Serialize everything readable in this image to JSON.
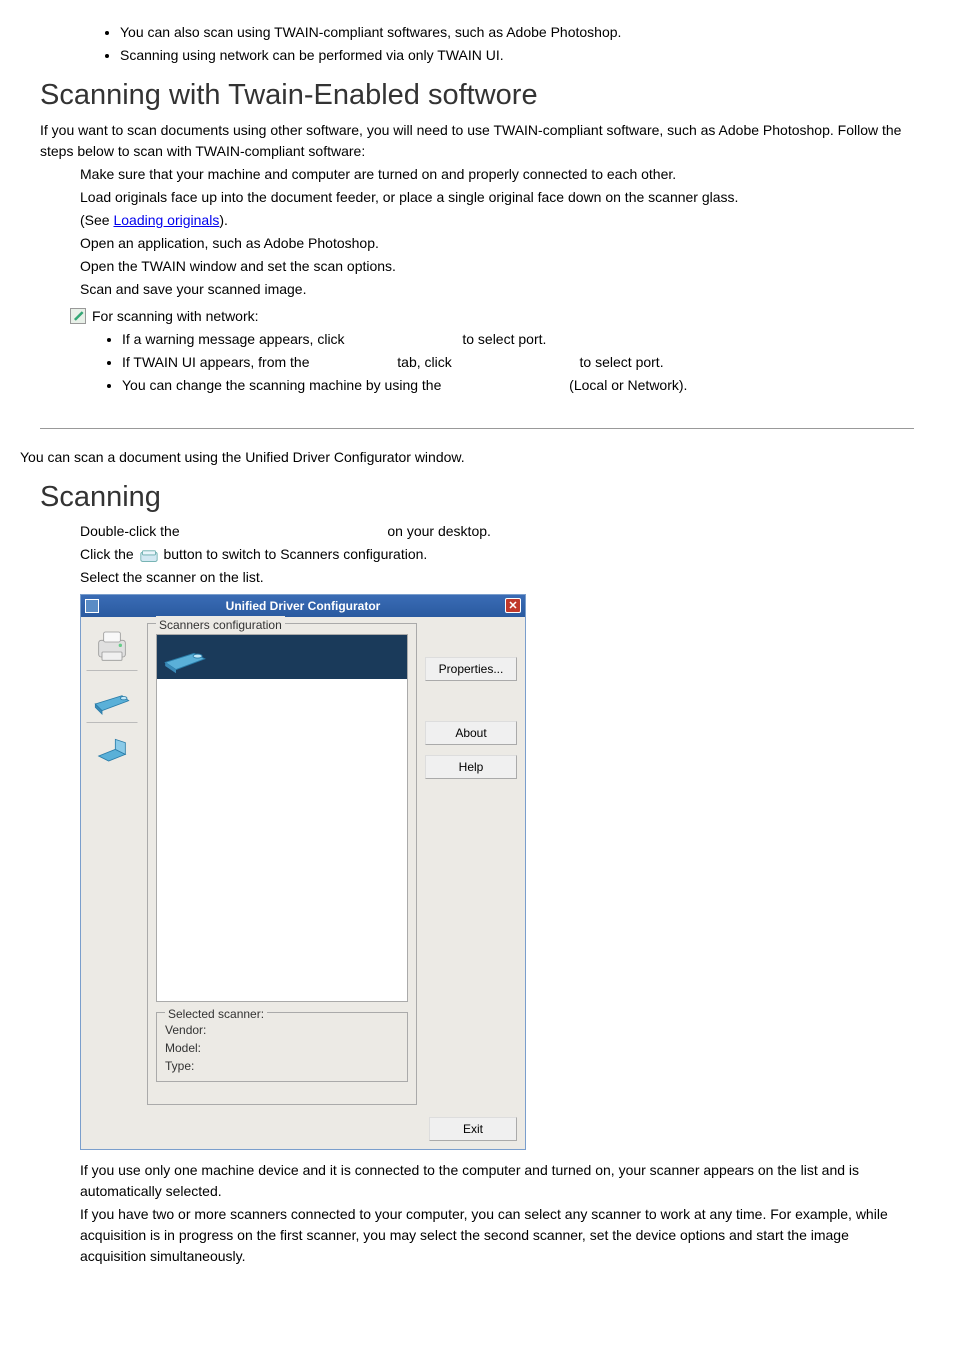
{
  "intro_bullets": [
    "You can also scan using TWAIN-compliant softwares, such as Adobe Photoshop.",
    "Scanning using network can be performed via only TWAIN UI."
  ],
  "section1": {
    "heading": "Scanning with Twain-Enabled softwore",
    "intro": "If you want to scan documents using other software, you will need to use TWAIN-compliant software, such as Adobe Photoshop. Follow the steps below to scan with TWAIN-compliant software:",
    "steps": {
      "s1": "Make sure that your machine and computer are turned on and properly connected to each other.",
      "s2a": "Load originals face up into the document feeder, or place a single original face down on the scanner glass.",
      "s2b_prefix": "(See ",
      "s2b_link": "Loading originals",
      "s2b_suffix": ").",
      "s3": "Open an application, such as Adobe Photoshop.",
      "s4": "Open the TWAIN window and set the scan options.",
      "s5": "Scan and save your scanned image."
    },
    "note_label": "For scanning with network:",
    "note_bullets": {
      "b1a": "If a warning message appears, click ",
      "b1b": " to select port.",
      "b2a": "If TWAIN UI appears, from the ",
      "b2b": " tab, click ",
      "b2c": " to select port.",
      "b3a": "You can change the scanning machine by using the ",
      "b3b": " (Local or Network)."
    }
  },
  "section2": {
    "lead": "You can scan a document using the Unified Driver Configurator window.",
    "heading": "Scanning",
    "step1a": "Double-click the ",
    "step1b": " on your desktop.",
    "step2a": "Click the ",
    "step2b": " button to switch to Scanners configuration.",
    "step3": "Select the scanner on the list.",
    "after1": "If you use only one machine device and it is connected to the computer and turned on, your scanner appears on the list and is automatically selected.",
    "after2": "If you have two or more scanners connected to your computer, you can select any scanner to work at any time. For example, while acquisition is in progress on the first scanner, you may select the second scanner, set the device options and start the image acquisition simultaneously."
  },
  "configurator": {
    "title": "Unified Driver Configurator",
    "group_title": "Scanners configuration",
    "selected_title": "Selected scanner:",
    "vendor": "Vendor:",
    "model": "Model:",
    "type": "Type:",
    "btn_properties": "Properties...",
    "btn_about": "About",
    "btn_help": "Help",
    "btn_exit": "Exit"
  }
}
